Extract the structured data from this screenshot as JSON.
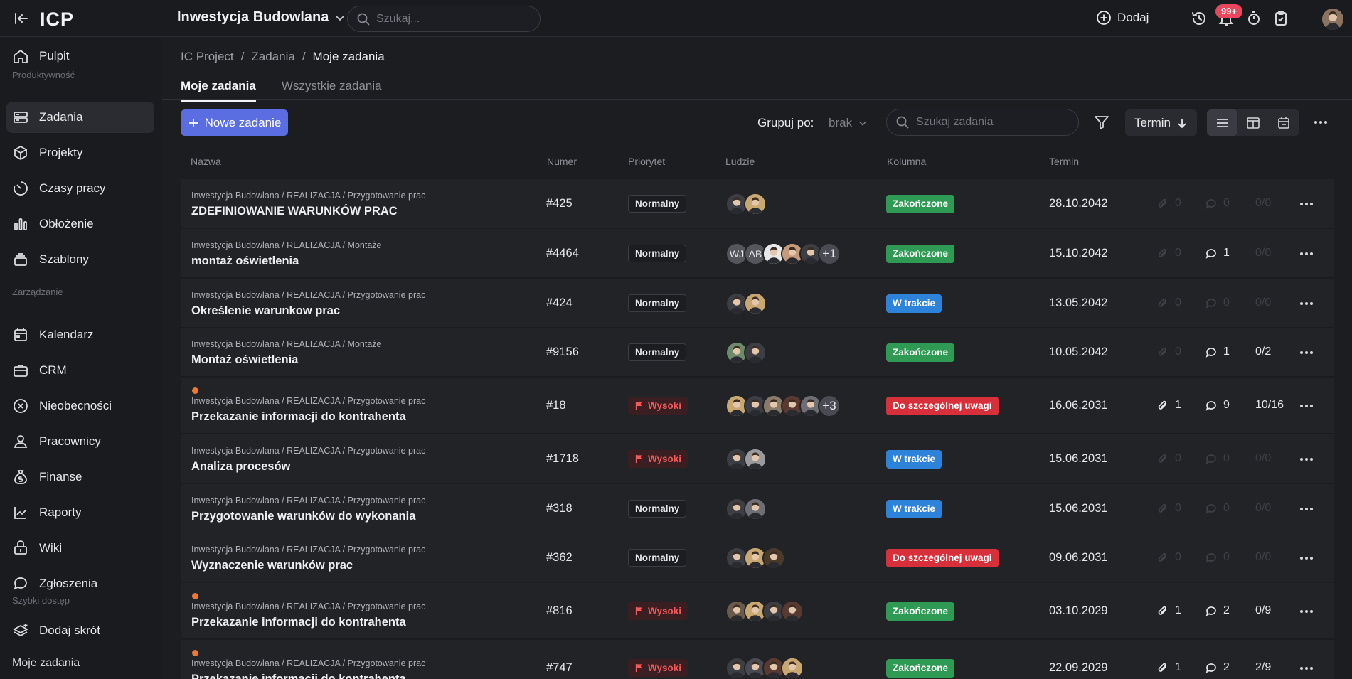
{
  "topbar": {
    "logo": "ICP",
    "project": "Inwestycja Budowlana",
    "search_placeholder": "Szukaj...",
    "add_label": "Dodaj",
    "notif_badge": "99+"
  },
  "sidebar": {
    "items": [
      {
        "label": "Pulpit",
        "icon": "home-icon"
      },
      {
        "label": "Zadania",
        "icon": "tasks-icon"
      },
      {
        "label": "Projekty",
        "icon": "cube-icon"
      },
      {
        "label": "Czasy pracy",
        "icon": "timer-icon"
      },
      {
        "label": "Obłożenie",
        "icon": "bar-chart-icon"
      },
      {
        "label": "Szablony",
        "icon": "layers-icon"
      },
      {
        "label": "Kalendarz",
        "icon": "calendar-icon"
      },
      {
        "label": "CRM",
        "icon": "briefcase-icon"
      },
      {
        "label": "Nieobecności",
        "icon": "close-circle-icon"
      },
      {
        "label": "Pracownicy",
        "icon": "person-icon"
      },
      {
        "label": "Finanse",
        "icon": "money-bag-icon"
      },
      {
        "label": "Raporty",
        "icon": "trend-icon"
      },
      {
        "label": "Wiki",
        "icon": "book-icon"
      },
      {
        "label": "Zgłoszenia",
        "icon": "chat-icon"
      },
      {
        "label": "Dodaj skrót",
        "icon": "stack-plus-icon"
      }
    ],
    "sections": [
      "Produktywność",
      "Zarządzanie",
      "Szybki dostęp",
      "Moje zadania"
    ]
  },
  "breadcrumb": {
    "root": "IC Project",
    "mid": "Zadania",
    "current": "Moje zadania"
  },
  "tabs": [
    "Moje zadania",
    "Wszystkie zadania"
  ],
  "toolbar": {
    "new_task": "Nowe zadanie",
    "group_by": "Grupuj po:",
    "group_by_value": "brak",
    "search_placeholder": "Szukaj zadania",
    "sort_label": "Termin"
  },
  "columns": [
    "Nazwa",
    "Numer",
    "Priorytet",
    "Ludzie",
    "Kolumna",
    "Termin"
  ],
  "rows": [
    {
      "path": "Inwestycja Budowlana / REALIZACJA / Przygotowanie prac",
      "title": "ZDEFINIOWANIE WARUNKÓW PRAC",
      "number": "#425",
      "priority": "Normalny",
      "status": "Zakończone",
      "due": "28.10.2042",
      "attachments": "0",
      "comments": "0",
      "checklist": "0/0",
      "people_extra": ""
    },
    {
      "path": "Inwestycja Budowlana / REALIZACJA / Montaże",
      "title": "montaż oświetlenia",
      "number": "#4464",
      "priority": "Normalny",
      "status": "Zakończone",
      "due": "15.10.2042",
      "attachments": "0",
      "comments": "1",
      "checklist": "0/0",
      "people_extra": "+1",
      "initials": [
        "WJ",
        "AB"
      ]
    },
    {
      "path": "Inwestycja Budowlana / REALIZACJA / Przygotowanie prac",
      "title": "Określenie warunkow prac",
      "number": "#424",
      "priority": "Normalny",
      "status": "W trakcie",
      "due": "13.05.2042",
      "attachments": "0",
      "comments": "0",
      "checklist": "0/0",
      "people_extra": ""
    },
    {
      "path": "Inwestycja Budowlana / REALIZACJA / Montaże",
      "title": "Montaż oświetlenia",
      "number": "#9156",
      "priority": "Normalny",
      "status": "Zakończone",
      "due": "10.05.2042",
      "attachments": "0",
      "comments": "1",
      "checklist": "0/2",
      "people_extra": ""
    },
    {
      "path": "Inwestycja Budowlana / REALIZACJA / Przygotowanie prac",
      "title": "Przekazanie informacji do kontrahenta",
      "number": "#18",
      "priority": "Wysoki",
      "status": "Do szczególnej uwagi",
      "due": "16.06.2031",
      "attachments": "1",
      "comments": "9",
      "checklist": "10/16",
      "people_extra": "+3"
    },
    {
      "path": "Inwestycja Budowlana / REALIZACJA / Przygotowanie prac",
      "title": "Analiza procesów",
      "number": "#1718",
      "priority": "Wysoki",
      "status": "W trakcie",
      "due": "15.06.2031",
      "attachments": "0",
      "comments": "0",
      "checklist": "0/0",
      "people_extra": ""
    },
    {
      "path": "Inwestycja Budowlana / REALIZACJA / Przygotowanie prac",
      "title": "Przygotowanie warunków do wykonania",
      "number": "#318",
      "priority": "Normalny",
      "status": "W trakcie",
      "due": "15.06.2031",
      "attachments": "0",
      "comments": "0",
      "checklist": "0/0",
      "people_extra": ""
    },
    {
      "path": "Inwestycja Budowlana / REALIZACJA / Przygotowanie prac",
      "title": "Wyznaczenie warunków prac",
      "number": "#362",
      "priority": "Normalny",
      "status": "Do szczególnej uwagi",
      "due": "09.06.2031",
      "attachments": "0",
      "comments": "0",
      "checklist": "0/0",
      "people_extra": ""
    },
    {
      "path": "Inwestycja Budowlana / REALIZACJA / Przygotowanie prac",
      "title": "Przekazanie informacji do kontrahenta",
      "number": "#816",
      "priority": "Wysoki",
      "status": "Zakończone",
      "due": "03.10.2029",
      "attachments": "1",
      "comments": "2",
      "checklist": "0/9",
      "people_extra": ""
    },
    {
      "path": "Inwestycja Budowlana / REALIZACJA / Przygotowanie prac",
      "title": "Przekazanie informacji do kontrahenta",
      "number": "#747",
      "priority": "Wysoki",
      "status": "Zakończone",
      "due": "22.09.2029",
      "attachments": "1",
      "comments": "2",
      "checklist": "2/9",
      "people_extra": ""
    }
  ],
  "colors": {
    "accent": "#5b6ee1",
    "done": "#2f9a54",
    "progress": "#2d82d9",
    "attention": "#d8303a",
    "high": "#f05a5a"
  }
}
